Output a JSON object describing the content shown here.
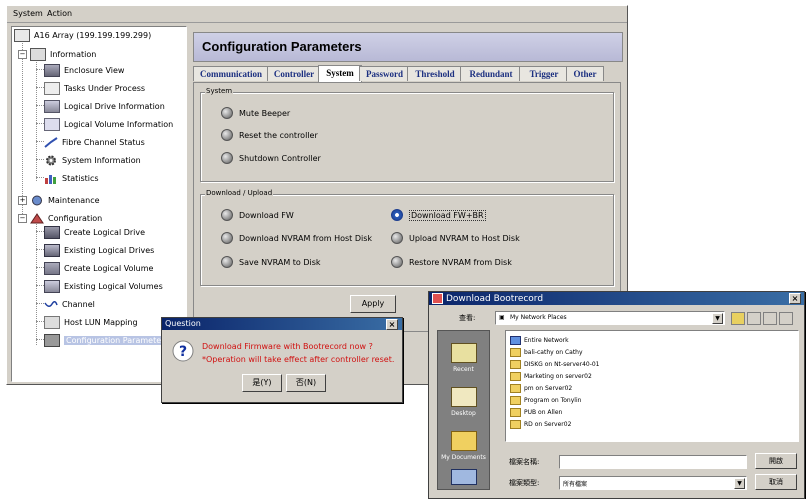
{
  "menubar": {
    "items": [
      "System",
      "Action"
    ]
  },
  "tree": {
    "root": "A16  Array (199.199.199.299)",
    "information": "Information",
    "info_items": [
      "Enclosure View",
      "Tasks Under Process",
      "Logical Drive Information",
      "Logical Volume Information",
      "Fibre Channel Status",
      "System Information",
      "Statistics"
    ],
    "maintenance": "Maintenance",
    "configuration": "Configuration",
    "config_items": [
      "Create Logical Drive",
      "Existing Logical Drives",
      "Create Logical Volume",
      "Existing Logical Volumes",
      "Channel",
      "Host LUN Mapping",
      "Configuration Parameters"
    ]
  },
  "config": {
    "title": "Configuration Parameters",
    "tabs": [
      "Communication",
      "Controller",
      "System",
      "Password",
      "Threshold",
      "Redundant",
      "Trigger",
      "Other"
    ],
    "active_tab": "System",
    "system_group": {
      "title": "System",
      "options": [
        "Mute Beeper",
        "Reset the controller",
        "Shutdown Controller"
      ]
    },
    "download_group": {
      "title": "Download / Upload",
      "left_options": [
        "Download FW",
        "Download NVRAM from Host Disk",
        "Save NVRAM to Disk"
      ],
      "right_options": [
        "Download FW+BR",
        "Upload NVRAM to Host Disk",
        "Restore NVRAM from Disk"
      ],
      "selected": "Download FW+BR"
    },
    "apply_label": "Apply"
  },
  "question": {
    "title": "Question",
    "line1": "Download Firmware with Bootrecord now ?",
    "line2": "*Operation will take effect after controller reset.",
    "yes_label": "是(Y)",
    "no_label": "否(N)",
    "text_color": "#d01010"
  },
  "bootrecord": {
    "title": "Download Bootrecord",
    "lookin_label": "查看:",
    "lookin_value": "My Network Places",
    "places": [
      "Recent",
      "Desktop",
      "My Documents"
    ],
    "files": [
      "Entire Network",
      "bali-cathy on Cathy",
      "DISKG on Nt-server40-01",
      "Marketing on server02",
      "pm on Server02",
      "Program on Tonylin",
      "PUB on Allen",
      "RD on Server02"
    ],
    "filename_label": "檔案名稱:",
    "filetype_label": "檔案類型:",
    "filetype_value": "所有檔案",
    "open_label": "開啟",
    "cancel_label": "取消"
  }
}
